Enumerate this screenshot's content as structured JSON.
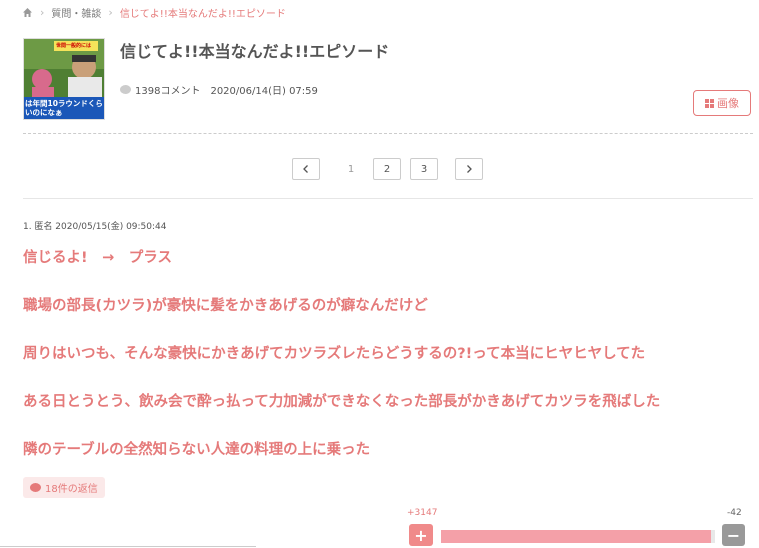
{
  "breadcrumb": {
    "home_icon": "home-icon",
    "category": "質問・雑談",
    "current": "信じてよ!!本当なんだよ!!エピソード"
  },
  "topic": {
    "title": "信じてよ!!本当なんだよ!!エピソード",
    "thumbnail_caption_top": "世間一般的には",
    "thumbnail_caption_bottom": "は年間10ラウンドくらいのになぁ",
    "comment_count": "1398コメント",
    "posted_at": "2020/06/14(日) 07:59",
    "image_button_label": "画像"
  },
  "pagination": {
    "prev_icon": "chevron-left-icon",
    "next_icon": "chevron-right-icon",
    "pages": [
      "1",
      "2",
      "3"
    ],
    "current_page": "1"
  },
  "comment": {
    "meta": "1. 匿名 2020/05/15(金) 09:50:44",
    "lines": [
      "信じるよ!　→　プラス",
      "職場の部長(カツラ)が豪快に髪をかきあげるのが癖なんだけど",
      "周りはいつも、そんな豪快にかきあげてカツラズレたらどうするの?!って本当にヒヤヒヤしてた",
      "ある日とうとう、飲み会で酔っ払って力加減ができなくなった部長がかきあげてカツラを飛ばした",
      "隣のテーブルの全然知らない人達の料理の上に乗った"
    ],
    "replies_label": "18件の返信",
    "plus_count": "+3147",
    "minus_count": "-42",
    "plus_label": "+",
    "minus_label": "−",
    "plus_ratio": 0.987
  },
  "colors": {
    "accent": "#e57a7a",
    "bar_fill": "#f4a0a8",
    "minus_button": "#999999"
  }
}
